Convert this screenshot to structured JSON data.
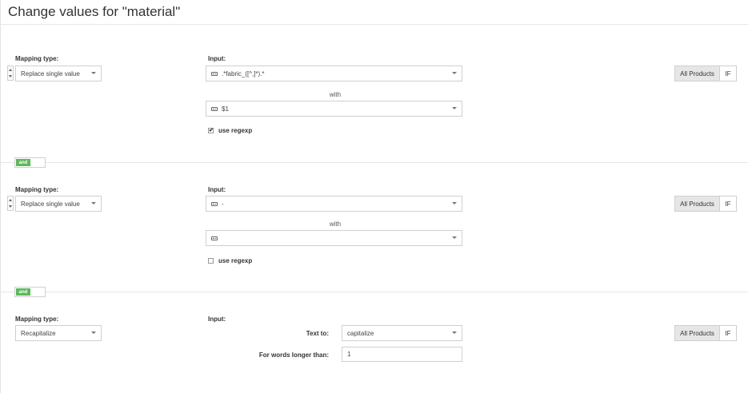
{
  "title": "Change values for \"material\"",
  "colors": {
    "accent_green": "#5cb85c",
    "border": "#cfcfcf",
    "segment_active_bg": "#e6e6e6"
  },
  "rules": [
    {
      "mapping_type_label": "Mapping type:",
      "mapping_type_value": "Replace single value",
      "input_label": "Input:",
      "input_value": ".*fabric_([^,]*).*",
      "with_label": "with",
      "with_value": "$1",
      "regexp_label": "use regexp",
      "regexp_checked": true,
      "scope_all": "All Products",
      "scope_if": "IF"
    },
    {
      "mapping_type_label": "Mapping type:",
      "mapping_type_value": "Replace single value",
      "input_label": "Input:",
      "input_value": "-",
      "with_label": "with",
      "with_value": "",
      "regexp_label": "use regexp",
      "regexp_checked": false,
      "scope_all": "All Products",
      "scope_if": "IF"
    },
    {
      "mapping_type_label": "Mapping type:",
      "mapping_type_value": "Recapitalize",
      "input_label": "Input:",
      "text_to_label": "Text to:",
      "text_to_value": "capitalize",
      "words_longer_label": "For words longer than:",
      "words_longer_value": "1",
      "scope_all": "All Products",
      "scope_if": "IF"
    }
  ],
  "connectors": [
    {
      "label": "and"
    },
    {
      "label": "and"
    }
  ]
}
